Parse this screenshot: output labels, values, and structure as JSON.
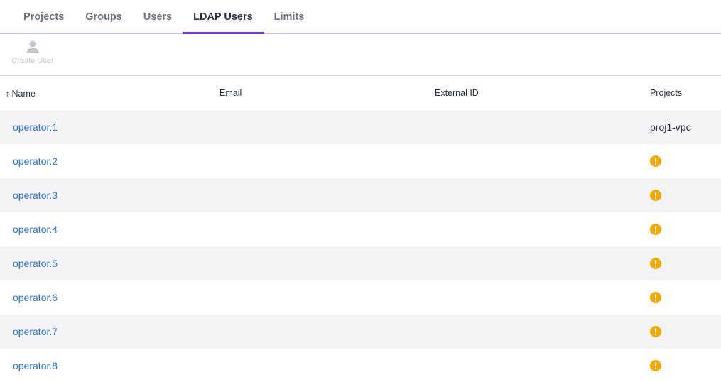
{
  "tabs": [
    {
      "label": "Projects",
      "active": false
    },
    {
      "label": "Groups",
      "active": false
    },
    {
      "label": "Users",
      "active": false
    },
    {
      "label": "LDAP Users",
      "active": true
    },
    {
      "label": "Limits",
      "active": false
    }
  ],
  "toolbar": {
    "create_user_label": "Create User",
    "create_user_icon": "user-icon",
    "create_user_disabled": true
  },
  "table": {
    "sort_indicator": "↑",
    "columns": [
      "Name",
      "Email",
      "External ID",
      "Projects"
    ],
    "rows": [
      {
        "name": "operator.1",
        "email": "",
        "external_id": "",
        "projects": "proj1-vpc"
      },
      {
        "name": "operator.2",
        "email": "",
        "external_id": "",
        "projects": "",
        "projects_icon": "warning-icon"
      },
      {
        "name": "operator.3",
        "email": "",
        "external_id": "",
        "projects": "",
        "projects_icon": "warning-icon"
      },
      {
        "name": "operator.4",
        "email": "",
        "external_id": "",
        "projects": "",
        "projects_icon": "warning-icon"
      },
      {
        "name": "operator.5",
        "email": "",
        "external_id": "",
        "projects": "",
        "projects_icon": "warning-icon"
      },
      {
        "name": "operator.6",
        "email": "",
        "external_id": "",
        "projects": "",
        "projects_icon": "warning-icon"
      },
      {
        "name": "operator.7",
        "email": "",
        "external_id": "",
        "projects": "",
        "projects_icon": "warning-icon"
      },
      {
        "name": "operator.8",
        "email": "",
        "external_id": "",
        "projects": "",
        "projects_icon": "warning-icon"
      }
    ]
  },
  "colors": {
    "accent": "#6b2fd6",
    "link": "#2a73d6",
    "warning": "#f5a800"
  }
}
